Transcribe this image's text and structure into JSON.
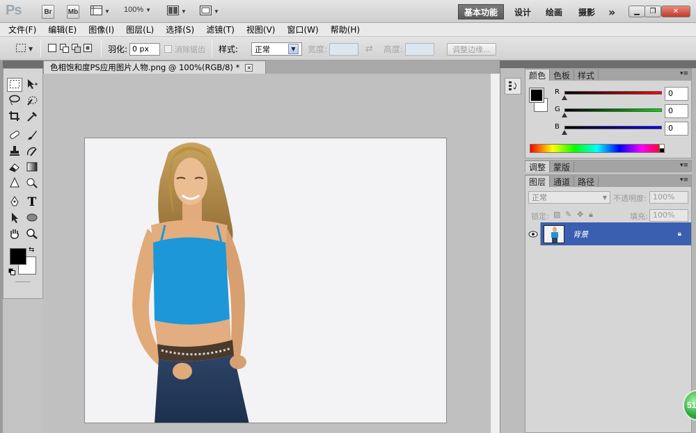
{
  "app": {
    "logo": "Ps",
    "bridge_label": "Br",
    "minibridge_label": "Mb",
    "zoom": "100%",
    "workspaces": [
      "基本功能",
      "设计",
      "绘画",
      "摄影"
    ],
    "more": "»"
  },
  "menu": [
    "文件(F)",
    "编辑(E)",
    "图像(I)",
    "图层(L)",
    "选择(S)",
    "滤镜(T)",
    "视图(V)",
    "窗口(W)",
    "帮助(H)"
  ],
  "options": {
    "feather_label": "羽化:",
    "feather_value": "0 px",
    "antialias_label": "消除锯齿",
    "style_label": "样式:",
    "style_value": "正常",
    "width_label": "宽度:",
    "height_label": "高度:",
    "refine_edge": "调整边缘..."
  },
  "document": {
    "tab_title": "色相饱和度PS应用图片人物.png @ 100%(RGB/8) *",
    "close": "×"
  },
  "color_panel": {
    "tabs": [
      "颜色",
      "色板",
      "样式"
    ],
    "r_label": "R",
    "g_label": "G",
    "b_label": "B",
    "r_value": "0",
    "g_value": "0",
    "b_value": "0"
  },
  "adjust_panel": {
    "tabs": [
      "调整",
      "蒙版"
    ]
  },
  "layers_panel": {
    "tabs": [
      "图层",
      "通道",
      "路径"
    ],
    "blend_mode": "正常",
    "opacity_label": "不透明度:",
    "opacity_value": "100%",
    "lock_label": "锁定:",
    "fill_label": "填充:",
    "fill_value": "100%",
    "layer_name": "背景"
  },
  "badge_text": "51",
  "colors": {
    "accent": "#3a5fb0",
    "fg_color": "#000000",
    "bg_color": "#ffffff"
  }
}
